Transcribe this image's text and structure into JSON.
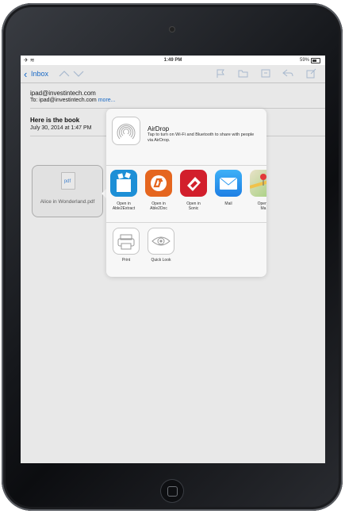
{
  "status": {
    "left_icons": "✈ ≋",
    "time": "1:49 PM",
    "battery_text": "59%"
  },
  "toolbar": {
    "back_label": "Inbox",
    "icons": [
      "up-arrow-icon",
      "down-arrow-icon",
      "flag-icon",
      "folder-icon",
      "archive-icon",
      "reply-icon",
      "compose-icon"
    ]
  },
  "mail": {
    "from": "ipad@investintech.com",
    "to_prefix": "To: ipad@investintech.com",
    "to_more": "more...",
    "subject": "Here is the book",
    "date": "July 30, 2014 at 1:47 PM"
  },
  "attachment": {
    "type_label": "pdf",
    "filename": "Alice in Wonderland.pdf"
  },
  "share_sheet": {
    "airdrop": {
      "title": "AirDrop",
      "description": "Tap to turn on Wi-Fi and Bluetooth to share with people via AirDrop."
    },
    "apps": [
      {
        "label": "Open in\nAble2Extract",
        "color": "#1d8fd6"
      },
      {
        "label": "Open in\nAble2Doc",
        "color": "#e5661f"
      },
      {
        "label": "Open in\nSonic",
        "color": "#d21f2c"
      },
      {
        "label": "Mail",
        "color": "#2f9bf0"
      },
      {
        "label": "Open i\nMa",
        "color": "#7fbf59"
      }
    ],
    "actions": [
      {
        "label": "Print"
      },
      {
        "label": "Quick Look"
      }
    ]
  }
}
